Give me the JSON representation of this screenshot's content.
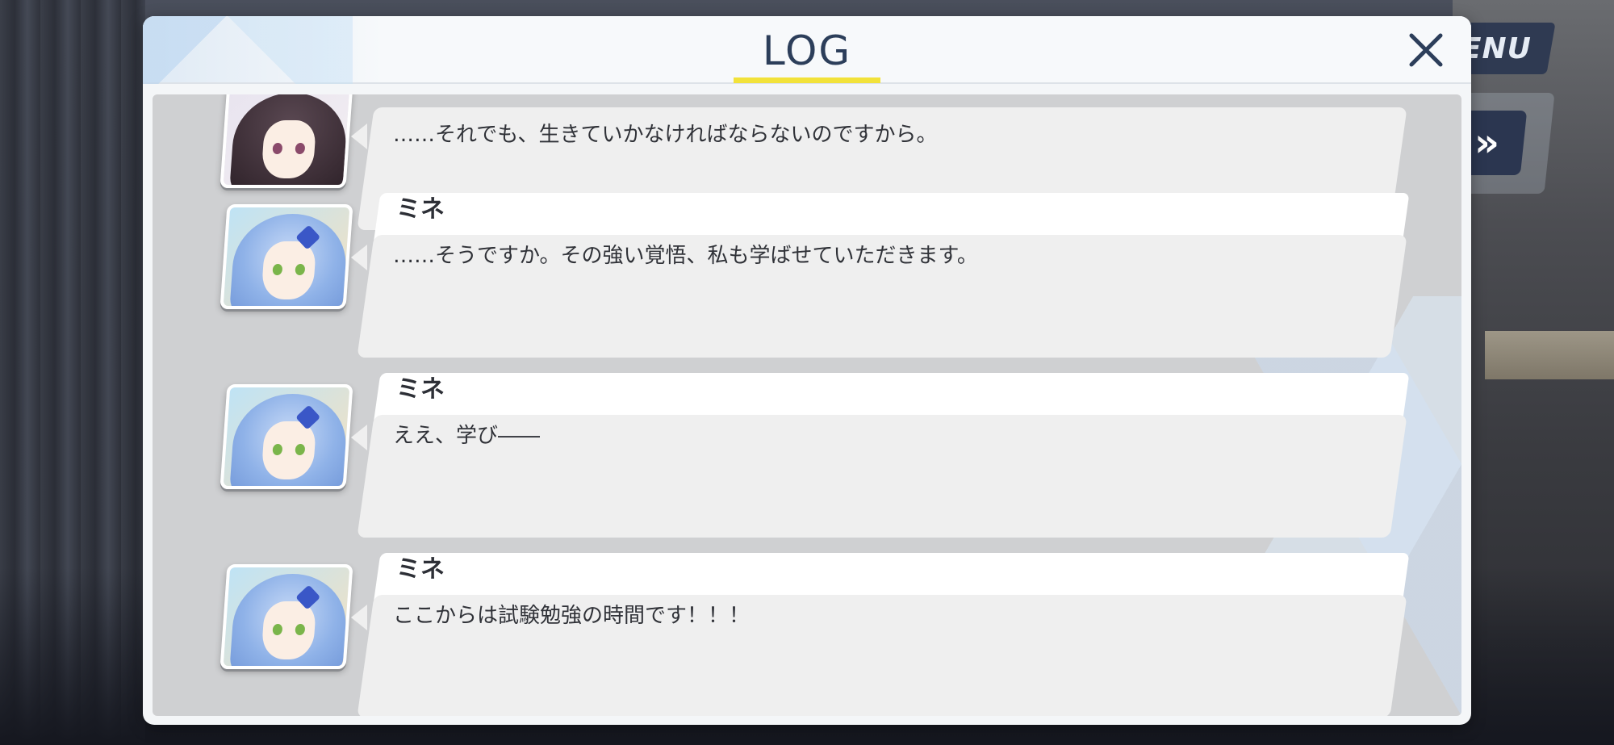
{
  "background": {
    "menu_label": "ENU",
    "skip_label": "»"
  },
  "log": {
    "title": "LOG",
    "close_label": "✕",
    "entries": [
      {
        "speaker": "",
        "text": "……それでも、生きていかなければならないのですから。",
        "avatar": "dark-haired-character-portrait"
      },
      {
        "speaker": "ミネ",
        "text": "……そうですか。その強い覚悟、私も学ばせていただきます。",
        "avatar": "mine-portrait"
      },
      {
        "speaker": "ミネ",
        "text": "ええ、学び――",
        "avatar": "mine-portrait"
      },
      {
        "speaker": "ミネ",
        "text": "ここからは試験勉強の時間です！！！",
        "avatar": "mine-portrait"
      }
    ]
  },
  "colors": {
    "title_underline": "#f2e23a",
    "title_text": "#2c3e5a",
    "menu_button": "#2f3a52"
  }
}
